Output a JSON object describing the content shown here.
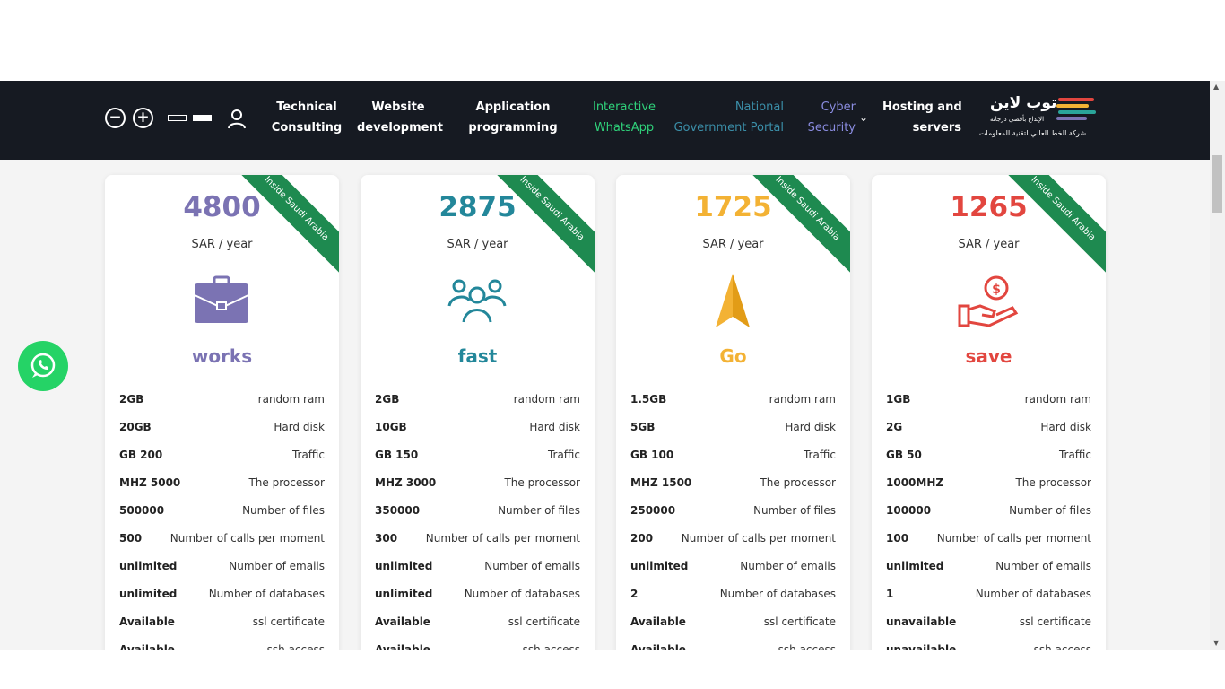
{
  "nav": {
    "accessibility": {
      "zoom_out_label": "−",
      "zoom_in_label": "+"
    },
    "links": [
      {
        "line1": "Technical",
        "line2": "Consulting"
      },
      {
        "line1": "Website",
        "line2": "development"
      },
      {
        "line1": "Application",
        "line2": "programming"
      },
      {
        "line1": "Interactive",
        "line2": "WhatsApp"
      },
      {
        "line1": "National",
        "line2": "Government Portal"
      },
      {
        "line1": "Cyber",
        "line2": "Security"
      },
      {
        "line1": "Hosting and",
        "line2": "servers"
      }
    ],
    "colors": {
      "green": "#2fd17a",
      "blue": "#3b8fa9",
      "purple": "#8a8ce0"
    },
    "logo": {
      "title": "توب لاين",
      "tagline": "الإبداع بأقصى درجاته",
      "company": "شركة الخط العالي لتقنية المعلومات"
    }
  },
  "ribbon_text": "Inside Saudi Arabia",
  "per_label": "SAR / year",
  "plans": [
    {
      "price": "4800",
      "name": "works",
      "color": "#7b73b3",
      "icon": "briefcase-icon",
      "specs": [
        {
          "value": "2GB",
          "label": "random ram"
        },
        {
          "value": "20GB",
          "label": "Hard disk"
        },
        {
          "value": "GB 200",
          "label": "Traffic"
        },
        {
          "value": "MHZ 5000",
          "label": "The processor"
        },
        {
          "value": "500000",
          "label": "Number of files"
        },
        {
          "value": "500",
          "label": "Number of calls per moment"
        },
        {
          "value": "unlimited",
          "label": "Number of emails"
        },
        {
          "value": "unlimited",
          "label": "Number of databases"
        },
        {
          "value": "Available",
          "label": "ssl certificate"
        },
        {
          "value": "Available",
          "label": "ssh access"
        }
      ]
    },
    {
      "price": "2875",
      "name": "fast",
      "color": "#23879a",
      "icon": "team-icon",
      "specs": [
        {
          "value": "2GB",
          "label": "random ram"
        },
        {
          "value": "10GB",
          "label": "Hard disk"
        },
        {
          "value": "GB 150",
          "label": "Traffic"
        },
        {
          "value": "MHZ 3000",
          "label": "The processor"
        },
        {
          "value": "350000",
          "label": "Number of files"
        },
        {
          "value": "300",
          "label": "Number of calls per moment"
        },
        {
          "value": "unlimited",
          "label": "Number of emails"
        },
        {
          "value": "unlimited",
          "label": "Number of databases"
        },
        {
          "value": "Available",
          "label": "ssl certificate"
        },
        {
          "value": "Available",
          "label": "ssh access"
        }
      ]
    },
    {
      "price": "1725",
      "name": "Go",
      "color": "#f3b234",
      "icon": "arrow-up-icon",
      "specs": [
        {
          "value": "1.5GB",
          "label": "random ram"
        },
        {
          "value": "5GB",
          "label": "Hard disk"
        },
        {
          "value": "GB 100",
          "label": "Traffic"
        },
        {
          "value": "MHZ 1500",
          "label": "The processor"
        },
        {
          "value": "250000",
          "label": "Number of files"
        },
        {
          "value": "200",
          "label": "Number of calls per moment"
        },
        {
          "value": "unlimited",
          "label": "Number of emails"
        },
        {
          "value": "2",
          "label": "Number of databases"
        },
        {
          "value": "Available",
          "label": "ssl certificate"
        },
        {
          "value": "Available",
          "label": "ssh access"
        }
      ]
    },
    {
      "price": "1265",
      "name": "save",
      "color": "#e2463f",
      "icon": "money-hand-icon",
      "specs": [
        {
          "value": "1GB",
          "label": "random ram"
        },
        {
          "value": "2G",
          "label": "Hard disk"
        },
        {
          "value": "GB 50",
          "label": "Traffic"
        },
        {
          "value": "1000MHZ",
          "label": "The processor"
        },
        {
          "value": "100000",
          "label": "Number of files"
        },
        {
          "value": "100",
          "label": "Number of calls per moment"
        },
        {
          "value": "unlimited",
          "label": "Number of emails"
        },
        {
          "value": "1",
          "label": "Number of databases"
        },
        {
          "value": "unavailable",
          "label": "ssl certificate"
        },
        {
          "value": "unavailable",
          "label": "ssh access"
        }
      ]
    }
  ],
  "whatsapp_color": "#25d366"
}
